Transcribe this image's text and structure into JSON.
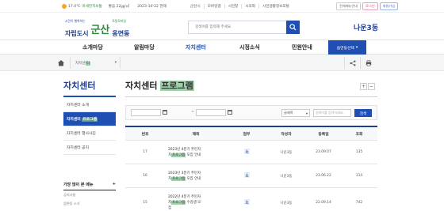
{
  "topbar": {
    "temperature": "17.0℃",
    "weather_label": "미세먼지보통",
    "pm": "좋음 22㎍/㎥",
    "date": "2023-10-22 현재",
    "links": [
      "군산시",
      "모바일앱",
      "시민청",
      "시의회",
      "시민생활정보포털"
    ],
    "btns": [
      "전체메뉴안내",
      "로그인",
      "회원가입"
    ]
  },
  "header": {
    "logo_tagline": "시민이 행복하는",
    "logo_city": "자립도시",
    "logo_name": "군산",
    "logo_sub": "토탈모바일",
    "logo_dong": "옹면동",
    "search_placeholder": "검색어를 입력해 주세요.",
    "dong_name": "나운3동"
  },
  "nav": {
    "items": [
      "소개마당",
      "알림마당",
      "자치센터",
      "시정소식",
      "민원안내"
    ],
    "active_index": 2,
    "dong_select": "읍면동선택"
  },
  "breadcrumb": {
    "segment_prefix": "자치센",
    "segment_hl": "터"
  },
  "sidebar": {
    "title": "자치센터",
    "items": [
      {
        "pre": "자치센터 소개",
        "hl": "",
        "post": ""
      },
      {
        "pre": "자치센터 ",
        "hl": "프로그램",
        "post": ""
      },
      {
        "pre": "자치센터 행사사진",
        "hl": "",
        "post": ""
      },
      {
        "pre": "자치센터 공지",
        "hl": "",
        "post": ""
      }
    ],
    "active_index": 1,
    "freq_title": "가장 많이 본 메뉴",
    "freq_items": [
      "공지사항",
      "읍면동 소식"
    ]
  },
  "main": {
    "title_pre": "자치센터 ",
    "title_hl": "프로그램",
    "zoom_in": "+",
    "zoom_out": "−",
    "filter": {
      "select_value": "글제목",
      "keyword_placeholder": "검색어를 입력하세요.",
      "search_label": "검색"
    },
    "columns": [
      "번호",
      "제목",
      "첨부",
      "작성자",
      "등록일",
      "조회"
    ],
    "rows": [
      {
        "no": "17",
        "t1": "2023년 4분기 주민자",
        "t2pre": "치",
        "t2hl": "프로그램",
        "t2post": " 모집 안내",
        "author": "나운3동",
        "date": "23.09.07",
        "views": "135"
      },
      {
        "no": "16",
        "t1": "2023년 3분기 주민자",
        "t2pre": "치",
        "t2hl": "프로그램",
        "t2post": " 모집 안내",
        "author": "나운3동",
        "date": "23.06.22",
        "views": "114"
      },
      {
        "no": "15",
        "t1": "2022년 4분기 주민자",
        "t2pre": "치",
        "t2hl": "프로그램",
        "t2post": " 수강생 모",
        "t3": "집",
        "author": "나운3동",
        "date": "22.09.14",
        "views": "742"
      }
    ]
  },
  "colors": {
    "brand": "#1f4fb3",
    "highlight": "#9fcfa8"
  }
}
